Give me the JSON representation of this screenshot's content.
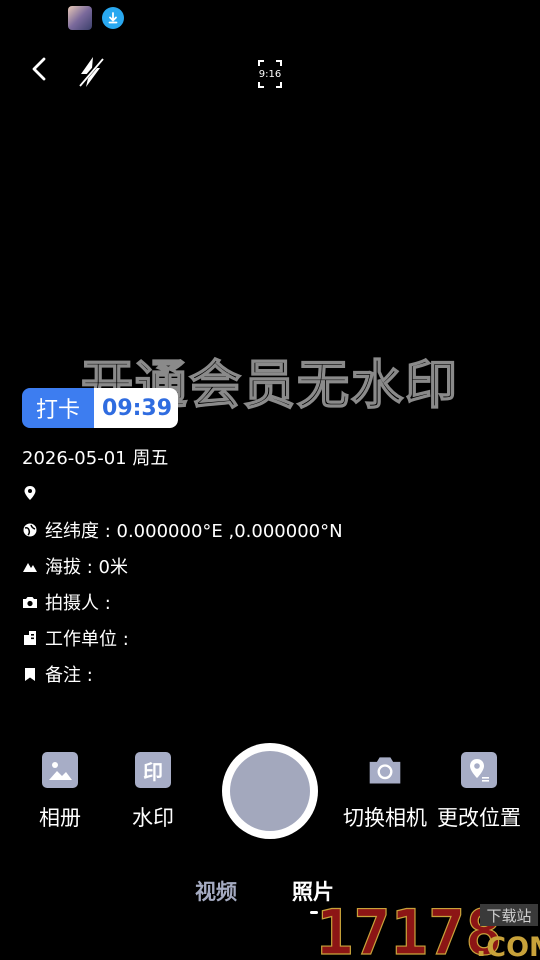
{
  "status_bar": {
    "icons": [
      "avatar-icon",
      "download-icon"
    ]
  },
  "toolbar": {
    "aspect_ratio": "9:16"
  },
  "watermark_banner": "开通会员无水印",
  "punch": {
    "label": "打卡",
    "time": "09:39"
  },
  "info": {
    "date": "2026-05-01 周五",
    "location": "",
    "coordinates": "经纬度 : 0.000000°E ,0.000000°N",
    "altitude": "海拔 : 0米",
    "photographer": "拍摄人 :",
    "work_unit": "工作单位 :",
    "remark": "备注 :"
  },
  "controls": {
    "album": "相册",
    "watermark": "水印",
    "watermark_icon_text": "印",
    "switch_camera": "切换相机",
    "change_location": "更改位置"
  },
  "modes": {
    "video": "视频",
    "photo": "照片",
    "active": "photo"
  },
  "colors": {
    "accent_blue": "#3d7df0",
    "time_text": "#2f6ce0",
    "icon_tile": "#a7adc6",
    "shutter_inner": "#a3a8bd",
    "inactive_tab": "#a5abc2",
    "brand_red": "#8c1515",
    "brand_gold": "#c8a23a"
  },
  "brand": {
    "number": "17178",
    "tag": "下载站",
    "domain": ".COM"
  }
}
